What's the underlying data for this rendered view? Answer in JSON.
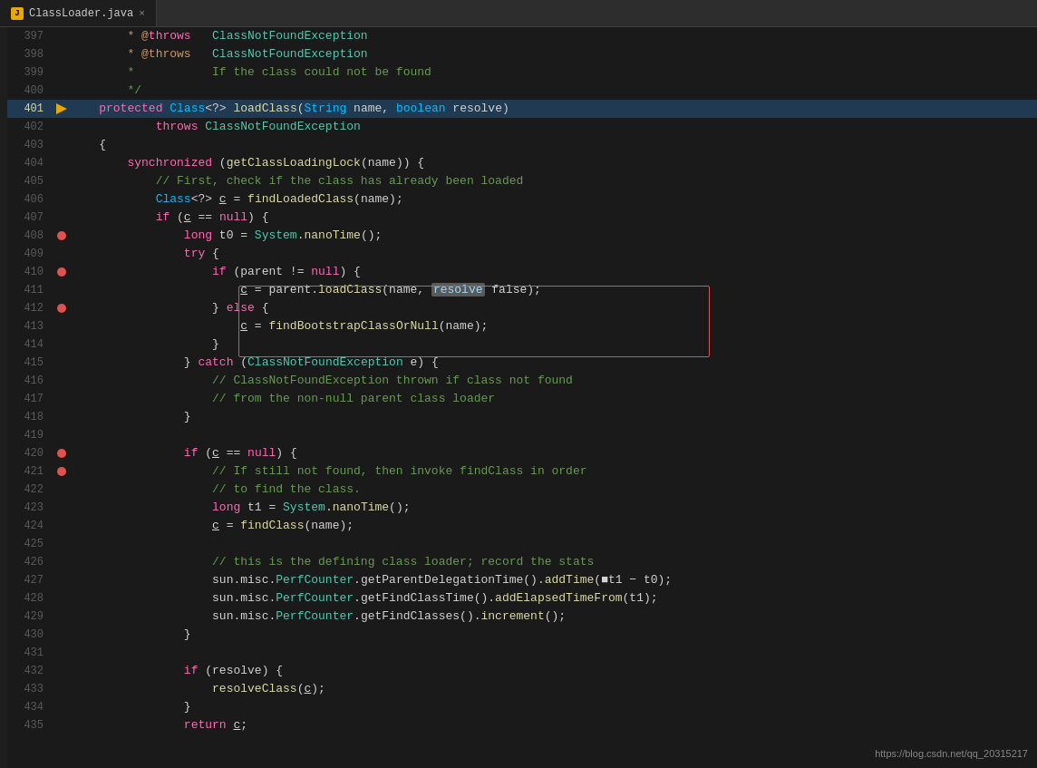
{
  "tab": {
    "label": "ClassLoader.java",
    "icon": "J",
    "close": "×"
  },
  "watermark": "https://blog.csdn.net/qq_20315217",
  "lines": [
    {
      "num": 397,
      "bp": "",
      "indent": "        ",
      "content": [
        {
          "t": "* @",
          "c": "javadoc-tag"
        },
        {
          "t": "throws",
          "c": "kw"
        },
        {
          "t": "   ",
          "c": "plain"
        },
        {
          "t": "ClassNotFoundException",
          "c": "javadoc-type"
        }
      ]
    },
    {
      "num": 398,
      "bp": "",
      "indent": "        ",
      "content": [
        {
          "t": "* @throws   ",
          "c": "javadoc-tag"
        },
        {
          "t": "ClassNotFoundException",
          "c": "javadoc-type"
        }
      ]
    },
    {
      "num": 399,
      "bp": "",
      "indent": "        ",
      "content": [
        {
          "t": "*           If the class could not be found",
          "c": "comment"
        }
      ]
    },
    {
      "num": 400,
      "bp": "",
      "indent": "        ",
      "content": [
        {
          "t": "*/",
          "c": "comment"
        }
      ]
    },
    {
      "num": 401,
      "bp": "arrow",
      "indent": "    ",
      "content": [
        {
          "t": "protected ",
          "c": "kw"
        },
        {
          "t": "Class",
          "c": "kw2"
        },
        {
          "t": "<?>",
          "c": "plain"
        },
        {
          "t": " ",
          "c": "plain"
        },
        {
          "t": "loadClass",
          "c": "method"
        },
        {
          "t": "(",
          "c": "punct"
        },
        {
          "t": "String",
          "c": "kw2"
        },
        {
          "t": " name, ",
          "c": "plain"
        },
        {
          "t": "boolean",
          "c": "kw2"
        },
        {
          "t": " resolve)",
          "c": "plain"
        }
      ],
      "active": true
    },
    {
      "num": 402,
      "bp": "",
      "indent": "            ",
      "content": [
        {
          "t": "throws ",
          "c": "kw"
        },
        {
          "t": "ClassNotFoundException",
          "c": "javadoc-type"
        }
      ]
    },
    {
      "num": 403,
      "bp": "",
      "indent": "    ",
      "content": [
        {
          "t": "{",
          "c": "plain"
        }
      ]
    },
    {
      "num": 404,
      "bp": "",
      "indent": "        ",
      "content": [
        {
          "t": "synchronized ",
          "c": "kw"
        },
        {
          "t": "(",
          "c": "punct"
        },
        {
          "t": "getClassLoadingLock",
          "c": "method"
        },
        {
          "t": "(name)) {",
          "c": "plain"
        }
      ]
    },
    {
      "num": 405,
      "bp": "",
      "indent": "            ",
      "content": [
        {
          "t": "// First, check if the class has already been loaded",
          "c": "comment"
        }
      ]
    },
    {
      "num": 406,
      "bp": "",
      "indent": "            ",
      "content": [
        {
          "t": "Class",
          "c": "kw2"
        },
        {
          "t": "<?> ",
          "c": "plain"
        },
        {
          "t": "c",
          "c": "var-underline plain"
        },
        {
          "t": " = ",
          "c": "plain"
        },
        {
          "t": "findLoadedClass",
          "c": "method"
        },
        {
          "t": "(name);",
          "c": "plain"
        }
      ]
    },
    {
      "num": 407,
      "bp": "",
      "indent": "            ",
      "content": [
        {
          "t": "if ",
          "c": "kw"
        },
        {
          "t": "(",
          "c": "punct"
        },
        {
          "t": "c",
          "c": "var-underline plain"
        },
        {
          "t": " == ",
          "c": "plain"
        },
        {
          "t": "null",
          "c": "kw"
        },
        {
          "t": ") {",
          "c": "plain"
        }
      ]
    },
    {
      "num": 408,
      "bp": "dot",
      "indent": "                ",
      "content": [
        {
          "t": "long ",
          "c": "kw"
        },
        {
          "t": "t0 = ",
          "c": "plain"
        },
        {
          "t": "System",
          "c": "type"
        },
        {
          "t": ".",
          "c": "plain"
        },
        {
          "t": "nanoTime",
          "c": "method"
        },
        {
          "t": "();",
          "c": "plain"
        }
      ]
    },
    {
      "num": 409,
      "bp": "",
      "indent": "                ",
      "content": [
        {
          "t": "try",
          "c": "kw"
        },
        {
          "t": " {",
          "c": "plain"
        }
      ]
    },
    {
      "num": 410,
      "bp": "dot",
      "indent": "                    ",
      "content": [
        {
          "t": "if ",
          "c": "kw"
        },
        {
          "t": "(parent != ",
          "c": "plain"
        },
        {
          "t": "null",
          "c": "kw"
        },
        {
          "t": ") {",
          "c": "plain"
        }
      ],
      "selected": true
    },
    {
      "num": 411,
      "bp": "",
      "indent": "                        ",
      "content": [
        {
          "t": "c",
          "c": "var-underline plain"
        },
        {
          "t": " = parent.",
          "c": "plain"
        },
        {
          "t": "loadClass",
          "c": "method"
        },
        {
          "t": "(name, ",
          "c": "plain"
        },
        {
          "t": "resolve",
          "c": "highlight-resolve"
        },
        {
          "t": " false);",
          "c": "plain"
        }
      ],
      "selected": true
    },
    {
      "num": 412,
      "bp": "dot",
      "indent": "                    ",
      "content": [
        {
          "t": "} ",
          "c": "plain"
        },
        {
          "t": "else",
          "c": "kw"
        },
        {
          "t": " {",
          "c": "plain"
        }
      ],
      "selected": true
    },
    {
      "num": 413,
      "bp": "",
      "indent": "                        ",
      "content": [
        {
          "t": "c",
          "c": "var-underline plain"
        },
        {
          "t": " = ",
          "c": "plain"
        },
        {
          "t": "findBootstrapClassOrNull",
          "c": "method"
        },
        {
          "t": "(name);",
          "c": "plain"
        }
      ]
    },
    {
      "num": 414,
      "bp": "",
      "indent": "                    ",
      "content": [
        {
          "t": "}",
          "c": "plain"
        }
      ]
    },
    {
      "num": 415,
      "bp": "",
      "indent": "                ",
      "content": [
        {
          "t": "} ",
          "c": "plain"
        },
        {
          "t": "catch ",
          "c": "kw"
        },
        {
          "t": "(",
          "c": "punct"
        },
        {
          "t": "ClassNotFoundException",
          "c": "javadoc-type"
        },
        {
          "t": " e) {",
          "c": "plain"
        }
      ]
    },
    {
      "num": 416,
      "bp": "",
      "indent": "                    ",
      "content": [
        {
          "t": "// ClassNotFoundException thrown if class not found",
          "c": "comment"
        }
      ]
    },
    {
      "num": 417,
      "bp": "",
      "indent": "                    ",
      "content": [
        {
          "t": "// from the non-null parent class loader",
          "c": "comment"
        }
      ]
    },
    {
      "num": 418,
      "bp": "",
      "indent": "                ",
      "content": [
        {
          "t": "}",
          "c": "plain"
        }
      ]
    },
    {
      "num": 419,
      "bp": "",
      "indent": "",
      "content": []
    },
    {
      "num": 420,
      "bp": "dot",
      "indent": "                ",
      "content": [
        {
          "t": "if ",
          "c": "kw"
        },
        {
          "t": "(",
          "c": "punct"
        },
        {
          "t": "c",
          "c": "var-underline plain"
        },
        {
          "t": " == ",
          "c": "plain"
        },
        {
          "t": "null",
          "c": "kw"
        },
        {
          "t": ") {",
          "c": "plain"
        }
      ]
    },
    {
      "num": 421,
      "bp": "dot",
      "indent": "                    ",
      "content": [
        {
          "t": "// If still not found, then invoke findClass in order",
          "c": "comment"
        }
      ]
    },
    {
      "num": 422,
      "bp": "",
      "indent": "                    ",
      "content": [
        {
          "t": "// to find the class.",
          "c": "comment"
        }
      ]
    },
    {
      "num": 423,
      "bp": "",
      "indent": "                    ",
      "content": [
        {
          "t": "long ",
          "c": "kw"
        },
        {
          "t": "t1 = ",
          "c": "plain"
        },
        {
          "t": "System",
          "c": "type"
        },
        {
          "t": ".",
          "c": "plain"
        },
        {
          "t": "nanoTime",
          "c": "method"
        },
        {
          "t": "();",
          "c": "plain"
        }
      ]
    },
    {
      "num": 424,
      "bp": "",
      "indent": "                    ",
      "content": [
        {
          "t": "c",
          "c": "var-underline plain"
        },
        {
          "t": " = ",
          "c": "plain"
        },
        {
          "t": "findClass",
          "c": "method"
        },
        {
          "t": "(name);",
          "c": "plain"
        }
      ]
    },
    {
      "num": 425,
      "bp": "",
      "indent": "",
      "content": []
    },
    {
      "num": 426,
      "bp": "",
      "indent": "                    ",
      "content": [
        {
          "t": "// this is the defining class loader; record the stats",
          "c": "comment"
        }
      ]
    },
    {
      "num": 427,
      "bp": "",
      "indent": "                    ",
      "content": [
        {
          "t": "sun.misc.",
          "c": "plain"
        },
        {
          "t": "PerfCounter",
          "c": "type"
        },
        {
          "t": ".getParentDelegationTime().",
          "c": "plain"
        },
        {
          "t": "addTime",
          "c": "method"
        },
        {
          "t": "(■t1 − t0);",
          "c": "plain"
        }
      ]
    },
    {
      "num": 428,
      "bp": "",
      "indent": "                    ",
      "content": [
        {
          "t": "sun.misc.",
          "c": "plain"
        },
        {
          "t": "PerfCounter",
          "c": "type"
        },
        {
          "t": ".getFindClassTime().",
          "c": "plain"
        },
        {
          "t": "addElapsedTimeFrom",
          "c": "method"
        },
        {
          "t": "(t1);",
          "c": "plain"
        }
      ]
    },
    {
      "num": 429,
      "bp": "",
      "indent": "                    ",
      "content": [
        {
          "t": "sun.misc.",
          "c": "plain"
        },
        {
          "t": "PerfCounter",
          "c": "type"
        },
        {
          "t": ".getFindClasses().",
          "c": "plain"
        },
        {
          "t": "increment",
          "c": "method"
        },
        {
          "t": "();",
          "c": "plain"
        }
      ]
    },
    {
      "num": 430,
      "bp": "",
      "indent": "                ",
      "content": [
        {
          "t": "}",
          "c": "plain"
        }
      ]
    },
    {
      "num": 431,
      "bp": "",
      "indent": "",
      "content": []
    },
    {
      "num": 432,
      "bp": "",
      "indent": "                ",
      "content": [
        {
          "t": "if ",
          "c": "kw"
        },
        {
          "t": "(resolve) {",
          "c": "plain"
        }
      ]
    },
    {
      "num": 433,
      "bp": "",
      "indent": "                    ",
      "content": [
        {
          "t": "resolveClass",
          "c": "method"
        },
        {
          "t": "(",
          "c": "punct"
        },
        {
          "t": "c",
          "c": "var-underline plain"
        },
        {
          "t": ");",
          "c": "plain"
        }
      ]
    },
    {
      "num": 434,
      "bp": "",
      "indent": "                ",
      "content": [
        {
          "t": "}",
          "c": "plain"
        }
      ]
    },
    {
      "num": 435,
      "bp": "",
      "indent": "                ",
      "content": [
        {
          "t": "return ",
          "c": "kw"
        },
        {
          "t": "c",
          "c": "var-underline plain"
        },
        {
          "t": ";",
          "c": "plain"
        }
      ]
    }
  ]
}
